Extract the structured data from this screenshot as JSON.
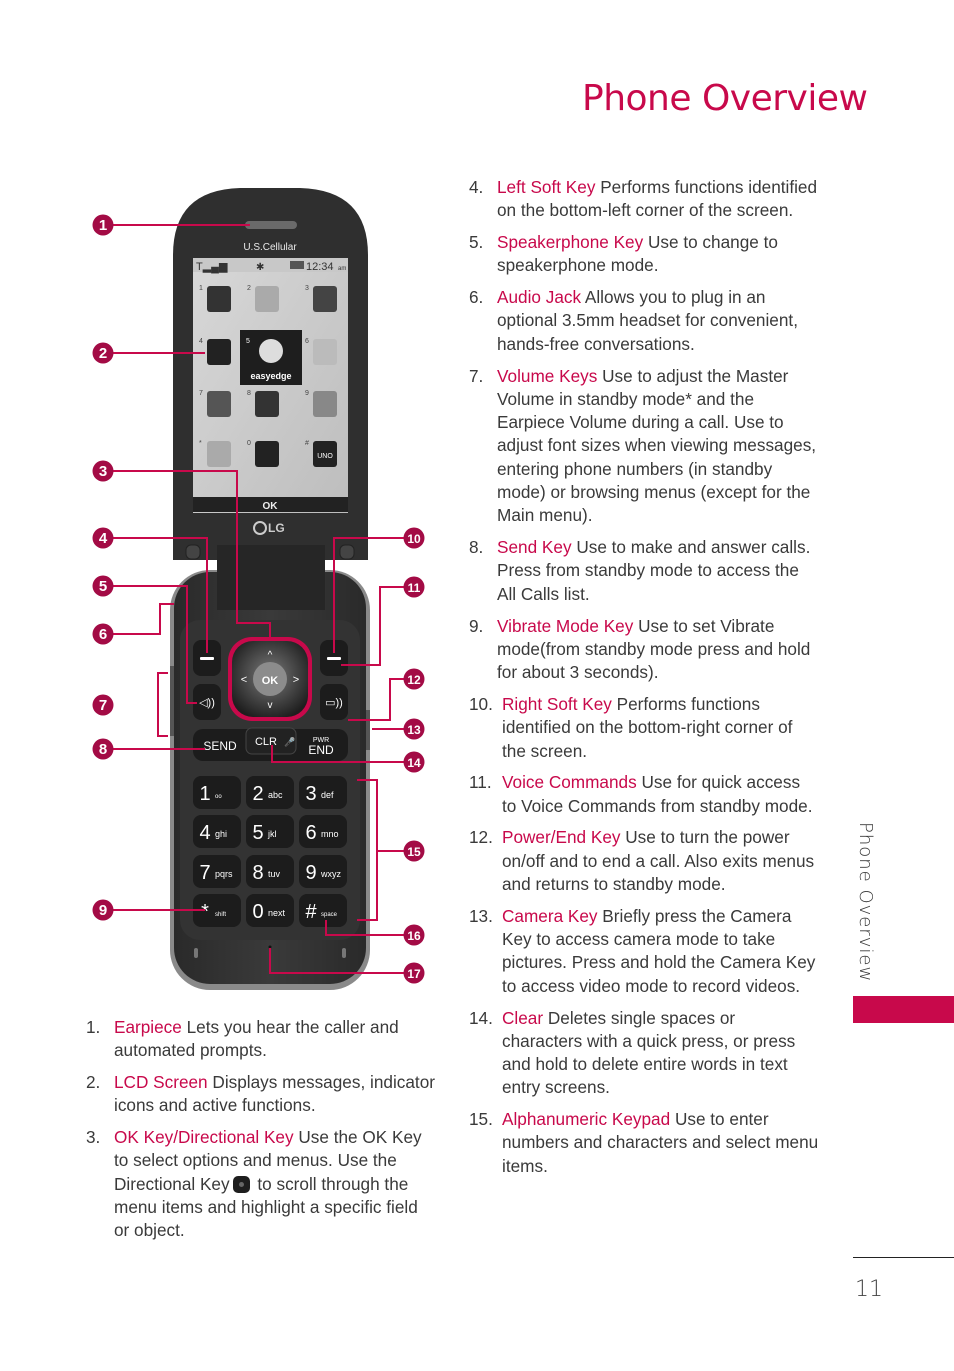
{
  "page": {
    "title": "Phone Overview",
    "side_tab_label": "Phone Overview",
    "page_number": "11",
    "accent_color": "#c8094b"
  },
  "phone": {
    "carrier_logo": "U.S.Cellular",
    "status_bar": {
      "time": "12:34",
      "ampm": "am",
      "signal_icon": "signal-icon",
      "bluetooth_icon": "bluetooth-off-icon",
      "battery_icon": "battery-icon"
    },
    "menu_grid": [
      {
        "key": "1",
        "icon": "contacts-icon"
      },
      {
        "key": "2",
        "icon": "messaging-icon"
      },
      {
        "key": "3",
        "icon": "recent-calls-icon"
      },
      {
        "key": "4",
        "icon": "multimedia-icon"
      },
      {
        "key": "5",
        "icon": "easyedge-icon",
        "label": "easyedge"
      },
      {
        "key": "6",
        "icon": "calendar-icon"
      },
      {
        "key": "7",
        "icon": "browser-globe-icon"
      },
      {
        "key": "8",
        "icon": "tools-icon"
      },
      {
        "key": "9",
        "icon": "settings-gear-icon"
      },
      {
        "key": "*",
        "icon": "music-icon"
      },
      {
        "key": "0",
        "icon": "bluetooth-icon"
      },
      {
        "key": "#",
        "icon": "uno-game-icon",
        "label": "UNO"
      }
    ],
    "softkey_label": "OK",
    "brand_logo": "LG",
    "keys": {
      "ok": "OK",
      "send": "SEND",
      "clr": "CLR",
      "pwr": "PWR",
      "end": "END"
    },
    "keypad": [
      {
        "digit": "1",
        "sub": "voicemail"
      },
      {
        "digit": "2",
        "sub": "abc"
      },
      {
        "digit": "3",
        "sub": "def"
      },
      {
        "digit": "4",
        "sub": "ghi"
      },
      {
        "digit": "5",
        "sub": "jkl"
      },
      {
        "digit": "6",
        "sub": "mno"
      },
      {
        "digit": "7",
        "sub": "pqrs"
      },
      {
        "digit": "8",
        "sub": "tuv"
      },
      {
        "digit": "9",
        "sub": "wxyz"
      },
      {
        "digit": "*",
        "sub": "shift"
      },
      {
        "digit": "0",
        "sub": "next"
      },
      {
        "digit": "#",
        "sub": "space"
      }
    ],
    "callouts": [
      "1",
      "2",
      "3",
      "4",
      "5",
      "6",
      "7",
      "8",
      "9",
      "10",
      "11",
      "12",
      "13",
      "14",
      "15",
      "16",
      "17"
    ]
  },
  "items_left": [
    {
      "num": "1.",
      "term": "Earpiece",
      "desc": " Lets you hear the caller and automated prompts."
    },
    {
      "num": "2.",
      "term": "LCD Screen",
      "desc": " Displays messages, indicator icons and active functions."
    },
    {
      "num": "3.",
      "term": "OK Key/Directional Key",
      "desc": " Use the OK Key to select options and menus. Use the Directional Key",
      "desc2": " to scroll through the menu items and highlight a specific field or object."
    }
  ],
  "items_right": [
    {
      "num": "4.",
      "term": "Left Soft Key",
      "desc": " Performs functions identified on the bottom-left corner of the screen."
    },
    {
      "num": "5.",
      "term": "Speakerphone Key",
      "desc": " Use to change to speakerphone mode."
    },
    {
      "num": "6.",
      "term": "Audio Jack",
      "desc": " Allows you to plug in an optional 3.5mm headset for convenient, hands-free conversations."
    },
    {
      "num": "7.",
      "term": "Volume Keys",
      "desc": " Use to adjust the Master Volume in standby mode* and the Earpiece Volume during a call. Use to adjust font sizes when viewing messages, entering phone numbers (in standby mode) or browsing menus (except for the Main menu)."
    },
    {
      "num": "8.",
      "term": "Send Key",
      "desc": " Use to make and answer calls. Press from standby mode to access the All Calls list."
    },
    {
      "num": "9.",
      "term": "Vibrate Mode Key",
      "desc": " Use to set Vibrate mode(from standby mode press and hold for about 3 seconds)."
    },
    {
      "num": "10.",
      "term": "Right Soft Key",
      "desc": " Performs functions identified on the bottom-right corner of the screen."
    },
    {
      "num": "11.",
      "term": "Voice Commands",
      "desc": " Use for quick access to Voice Commands from standby mode."
    },
    {
      "num": "12.",
      "term": "Power/End Key",
      "desc": " Use to turn the power on/off and to end a call. Also exits menus and returns to standby mode."
    },
    {
      "num": "13.",
      "term": "Camera Key",
      "desc": " Briefly press the Camera Key to access camera mode to take pictures. Press and hold the Camera Key to access video mode to record videos."
    },
    {
      "num": "14.",
      "term": "Clear",
      "desc": " Deletes single spaces or characters with a quick press, or press and hold to delete entire words in text entry screens."
    },
    {
      "num": "15.",
      "term": "Alphanumeric Keypad",
      "desc": " Use to enter numbers and characters and select menu items."
    }
  ]
}
